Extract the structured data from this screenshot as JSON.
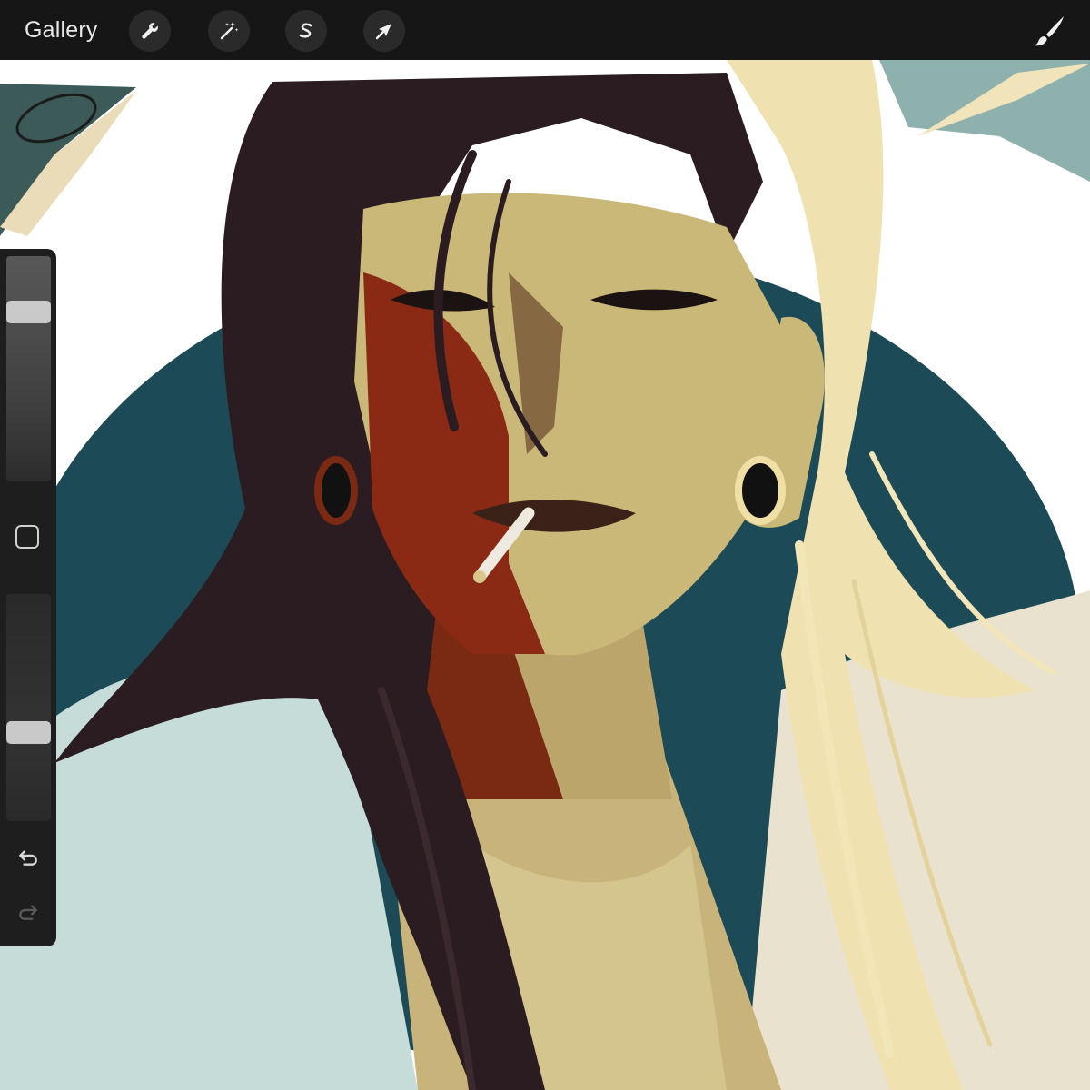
{
  "toolbar": {
    "gallery_label": "Gallery",
    "tools": [
      {
        "icon": "wrench-icon",
        "name": "actions"
      },
      {
        "icon": "magic-wand-icon",
        "name": "adjustments"
      },
      {
        "icon": "selection-s-icon",
        "name": "selection"
      },
      {
        "icon": "arrow-cursor-icon",
        "name": "transform"
      }
    ],
    "brush_icon": "paintbrush-icon"
  },
  "sidebar": {
    "brush_size_level": 0.78,
    "opacity_level": 0.38,
    "modify_icon": "square-icon",
    "undo_icon": "undo-arrow-icon",
    "redo_icon": "redo-arrow-icon"
  },
  "colors": {
    "toolbar_bg": "#161616",
    "sidebar_bg": "#1e1e1e",
    "teal_circle": "#1d4a57",
    "hair_dark": "#2a1c20",
    "hair_light": "#efe1b0",
    "skin": "#c9b878",
    "blood": "#8a2a14",
    "shirt": "#c8dcd8"
  }
}
